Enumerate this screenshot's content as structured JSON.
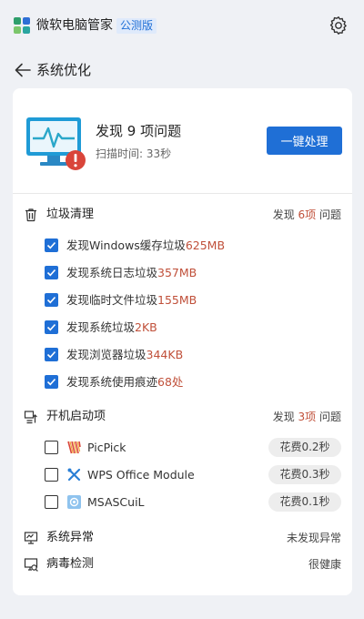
{
  "app": {
    "title": "微软电脑管家",
    "badge": "公测版"
  },
  "page": {
    "title": "系统优化"
  },
  "scan": {
    "title": "发现 9 项问题",
    "time": "扫描时间: 33秒",
    "fix_button": "一键处理"
  },
  "junk": {
    "title": "垃圾清理",
    "summary_prefix": "发现 ",
    "summary_count": "6项",
    "summary_suffix": " 问题",
    "items": [
      {
        "text": "发现Windows缓存垃圾",
        "value": "625MB",
        "checked": true
      },
      {
        "text": "发现系统日志垃圾",
        "value": "357MB",
        "checked": true
      },
      {
        "text": "发现临时文件垃圾",
        "value": "155MB",
        "checked": true
      },
      {
        "text": "发现系统垃圾",
        "value": "2KB",
        "checked": true
      },
      {
        "text": "发现浏览器垃圾",
        "value": "344KB",
        "checked": true
      },
      {
        "text": "发现系统使用痕迹",
        "value": "68处",
        "checked": true
      }
    ]
  },
  "startup": {
    "title": "开机启动项",
    "summary_prefix": "发现 ",
    "summary_count": "3项",
    "summary_suffix": " 问题",
    "items": [
      {
        "name": "PicPick",
        "cost": "花费0.2秒",
        "checked": false,
        "icon": "picpick-icon"
      },
      {
        "name": "WPS Office Module",
        "cost": "花费0.3秒",
        "checked": false,
        "icon": "wps-tools-icon"
      },
      {
        "name": "MSASCuiL",
        "cost": "花费0.1秒",
        "checked": false,
        "icon": "msascuil-icon"
      }
    ]
  },
  "system_error": {
    "title": "系统异常",
    "status": "未发现异常"
  },
  "virus": {
    "title": "病毒检测",
    "status": "很健康"
  },
  "colors": {
    "accent": "#1f6fd6",
    "highlight": "#c0503a",
    "background": "#eff1f5"
  }
}
